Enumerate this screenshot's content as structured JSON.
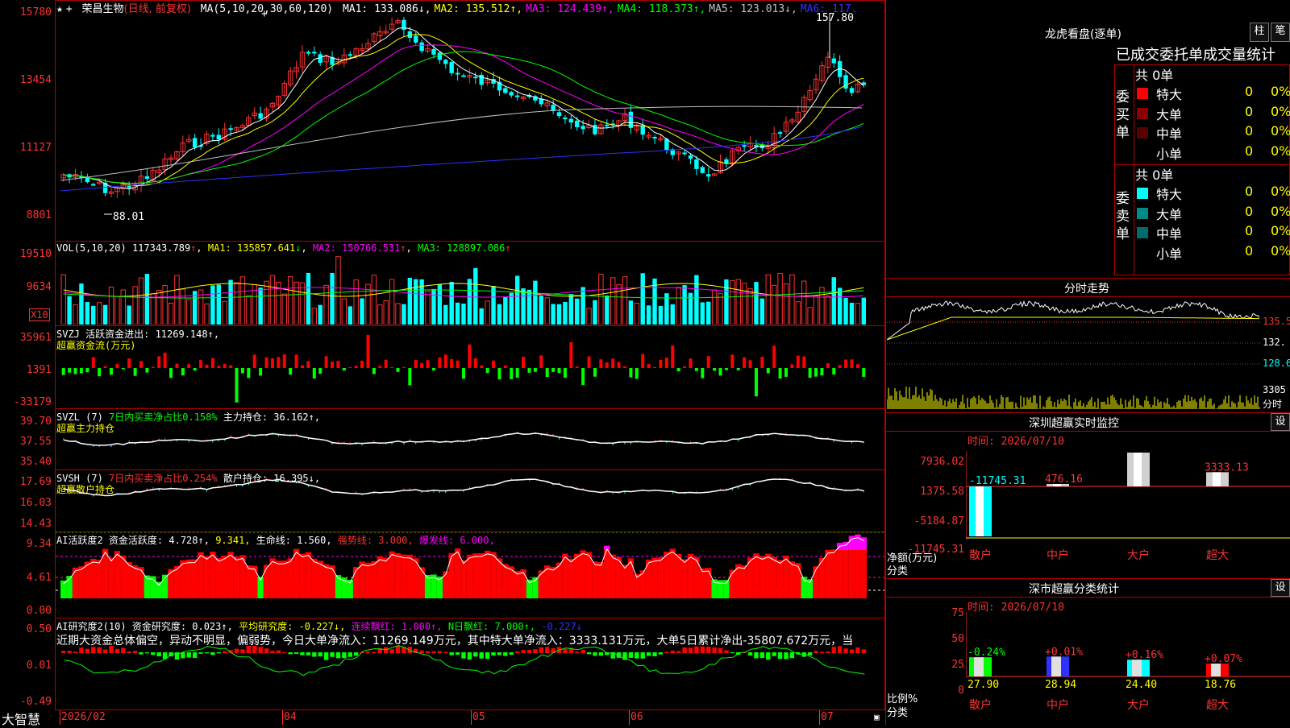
{
  "header": {
    "stock": "荣昌生物",
    "period": "(日线, 前复权)",
    "ma_def": "MA(5,10,20,30,60,120)",
    "ma": [
      {
        "label": "MA1:",
        "value": "133.086",
        "arrow": "↓",
        "color": "#ffffff"
      },
      {
        "label": "MA2:",
        "value": "135.512",
        "arrow": "↑",
        "color": "#ffff00"
      },
      {
        "label": "MA3:",
        "value": "124.439",
        "arrow": "↑",
        "color": "#ff00ff"
      },
      {
        "label": "MA4:",
        "value": "118.373",
        "arrow": "↑",
        "color": "#00ff00"
      },
      {
        "label": "MA5:",
        "value": "123.013",
        "arrow": "↓",
        "color": "#c0c0c0"
      },
      {
        "label": "MA6:",
        "value": "117.",
        "arrow": "",
        "color": "#3030ff"
      }
    ]
  },
  "price_axis": [
    "15780",
    "13454",
    "11127",
    "8801"
  ],
  "price_annotations": {
    "high": "157.80",
    "low": "88.01"
  },
  "volume": {
    "def": "VOL(5,10,20)",
    "value": "117343.789",
    "ma1": "MA1: 135857.641",
    "ma2": "MA2: 150766.531",
    "ma3": "MA3: 128897.086",
    "axis": [
      "19510",
      "9634"
    ],
    "unit": "X10"
  },
  "svzj": {
    "line1": "SVZJ  活跃资金进出: 11269.148↑,",
    "line2": "超赢资金流(万元)",
    "axis": [
      "35961",
      "1391",
      "-33179"
    ]
  },
  "svzl": {
    "line1a": "SVZL (7)",
    "line1b": "7日内买卖净占比0.158%",
    "line1c": "主力持仓: 36.162↑,",
    "line2": "超赢主力持仓",
    "axis": [
      "39.70",
      "37.55",
      "35.40"
    ]
  },
  "svsh": {
    "line1a": "SVSH (7)",
    "line1b": "7日内买卖净占比0.254%",
    "line1c": "散户持仓: 16.395↓,",
    "line2": "超赢散户持仓",
    "axis": [
      "17.69",
      "16.03",
      "14.43"
    ]
  },
  "ai_active": {
    "t1": "AI活跃度2",
    "t2": "资金活跃度: 4.728↑,",
    "t3": "9.341,",
    "t4": "生命线: 1.560,",
    "t5": "强势线: 3.000,",
    "t6": "爆发线: 6.000,",
    "axis": [
      "9.34",
      "4.61",
      "0.00"
    ]
  },
  "ai_research": {
    "t1": "AI研究度2(10)",
    "t2": "资金研究度: 0.023↑,",
    "t3": "平均研究度: -0.227↓,",
    "t4": "连续飘红: 1.000↑,",
    "t5": "N日飘红: 7.000↑,",
    "t6": "-0.227↓",
    "summary": "近期大资金总体偏空，异动不明显，偏弱势，今日大单净流入：11269.149万元，其中特大单净流入：3333.131万元，大单5日累计净出-35807.672万元，当",
    "axis": [
      "0.50",
      "0.01",
      "-0.49"
    ]
  },
  "date_axis": {
    "brand": "大智慧",
    "labels": [
      "2026/02",
      "04",
      "05",
      "06",
      "07"
    ]
  },
  "right": {
    "lhb_title": "龙虎看盘(逐单)",
    "btn_bar": "柱",
    "btn_pen": "笔",
    "tabs_text": "已成交委托单成交量统计",
    "buy_label": "委买单",
    "sell_label": "委卖单",
    "buy_total": "共 0单",
    "sell_total": "共 0单",
    "buy_rows": [
      {
        "name": "特大",
        "count": "0",
        "pct": "0%",
        "color": "#ff0000"
      },
      {
        "name": "大单",
        "count": "0",
        "pct": "0%",
        "color": "#8b0000"
      },
      {
        "name": "中单",
        "count": "0",
        "pct": "0%",
        "color": "#5a0000"
      },
      {
        "name": "小单",
        "count": "0",
        "pct": "0%",
        "color": "#000000"
      }
    ],
    "sell_rows": [
      {
        "name": "特大",
        "count": "0",
        "pct": "0%",
        "color": "#00ffff"
      },
      {
        "name": "大单",
        "count": "0",
        "pct": "0%",
        "color": "#008b8b"
      },
      {
        "name": "中单",
        "count": "0",
        "pct": "0%",
        "color": "#006b6b"
      },
      {
        "name": "小单",
        "count": "0",
        "pct": "0%",
        "color": "#000000"
      }
    ],
    "intraday_title": "分时走势",
    "intraday_axis": [
      "135.5",
      "132.",
      "128.6",
      "3305",
      "分时"
    ],
    "monitor_title": "深圳超赢实时监控",
    "monitor_btn": "设",
    "monitor_time": "时间: 2026/07/10",
    "monitor_axis": [
      "7936.02",
      "1375.58",
      "-5184.87",
      "-11745.31"
    ],
    "monitor_ylabel1": "净额(万元)",
    "monitor_ylabel2": "分类",
    "monitor_bars": [
      {
        "cat": "散户",
        "value": -11745.31,
        "label": "-11745.31"
      },
      {
        "cat": "中户",
        "value": 476.16,
        "label": "476.16"
      },
      {
        "cat": "大户",
        "value": 7936.02,
        "label": "7936.02"
      },
      {
        "cat": "超大",
        "value": 3333.13,
        "label": "3333.13"
      }
    ],
    "class_title": "深市超赢分类统计",
    "class_btn": "设",
    "class_time": "时间: 2026/07/10",
    "class_axis": [
      "75",
      "50",
      "25",
      "0"
    ],
    "class_ylabel1": "比例%",
    "class_ylabel2": "分类",
    "class_bars": [
      {
        "cat": "散户",
        "value": 27.9,
        "label": "27.90",
        "delta": "-0.24%",
        "delta_color": "#00ff00",
        "color": "#00ff00"
      },
      {
        "cat": "中户",
        "value": 28.94,
        "label": "28.94",
        "delta": "+0.01%",
        "delta_color": "#ff3232",
        "color": "#3030ff"
      },
      {
        "cat": "大户",
        "value": 24.4,
        "label": "24.40",
        "delta": "+0.16%",
        "delta_color": "#ff3232",
        "color": "#00ffff"
      },
      {
        "cat": "超大",
        "value": 18.76,
        "label": "18.76",
        "delta": "+0.07%",
        "delta_color": "#ff3232",
        "color": "#ff0000"
      }
    ]
  },
  "colors": {
    "up": "#ff3232",
    "down": "#00ffff",
    "border": "#b40000",
    "yellow": "#ffff00",
    "magenta": "#ff00ff",
    "green": "#00ff00"
  }
}
